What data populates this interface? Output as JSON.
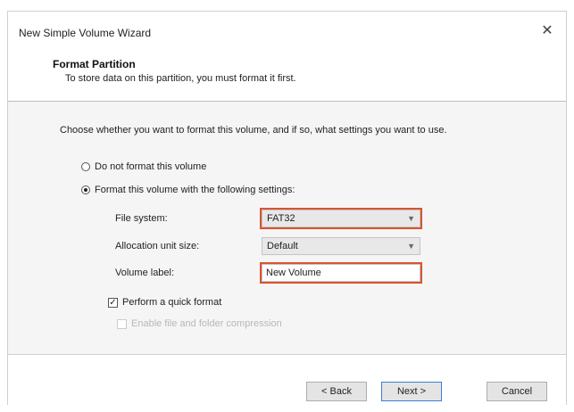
{
  "window": {
    "title": "New Simple Volume Wizard",
    "close_symbol": "✕"
  },
  "header": {
    "title": "Format Partition",
    "subtitle": "To store data on this partition, you must format it first."
  },
  "body": {
    "instruction": "Choose whether you want to format this volume, and if so, what settings you want to use.",
    "options": {
      "no_format": {
        "label": "Do not format this volume",
        "selected": false
      },
      "format": {
        "label": "Format this volume with the following settings:",
        "selected": true
      }
    },
    "fields": {
      "file_system": {
        "label": "File system:",
        "value": "FAT32"
      },
      "allocation_unit": {
        "label": "Allocation unit size:",
        "value": "Default"
      },
      "volume_label": {
        "label": "Volume label:",
        "value": "New Volume"
      }
    },
    "quick_format": {
      "label": "Perform a quick format",
      "checked": true
    },
    "compression": {
      "label": "Enable file and folder compression",
      "checked": false,
      "enabled": false
    }
  },
  "footer": {
    "back_label": "< Back",
    "next_label": "Next >",
    "cancel_label": "Cancel"
  },
  "colors": {
    "highlight": "#d9542e",
    "default_button_border": "#3c7fd1",
    "panel_background": "#f5f5f5"
  }
}
